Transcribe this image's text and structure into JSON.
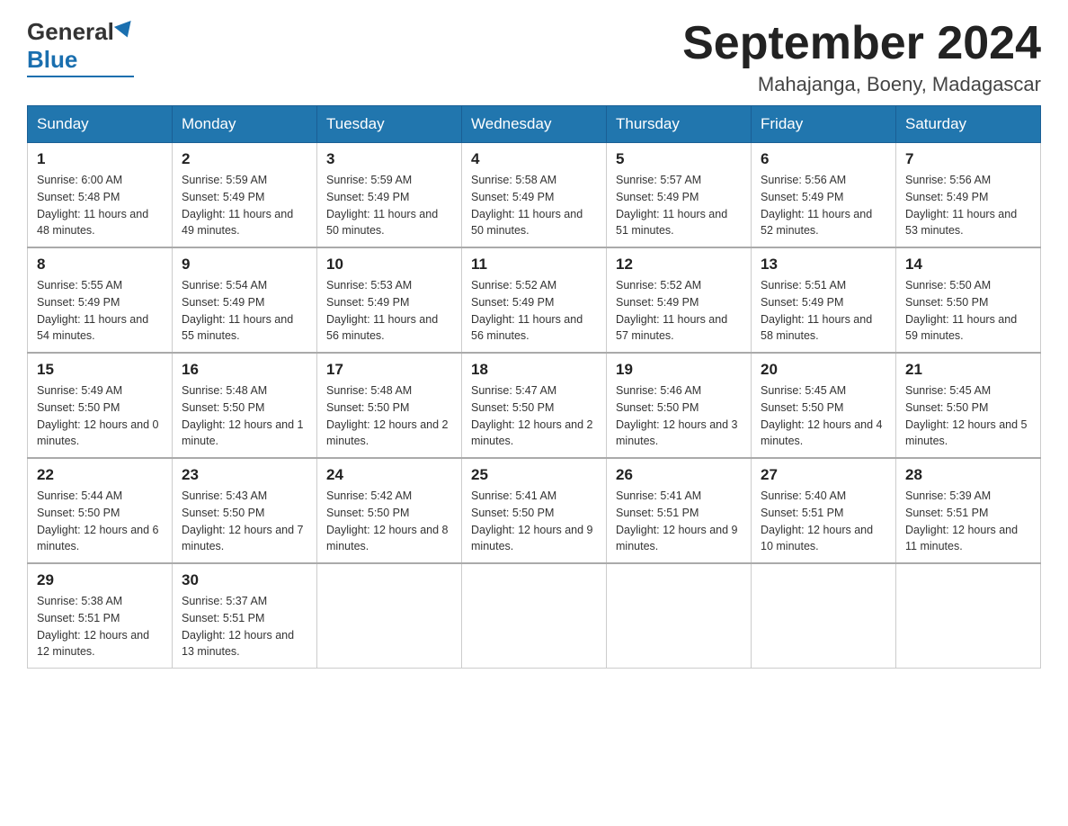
{
  "header": {
    "logo_general": "General",
    "logo_blue": "Blue",
    "title": "September 2024",
    "subtitle": "Mahajanga, Boeny, Madagascar"
  },
  "days_of_week": [
    "Sunday",
    "Monday",
    "Tuesday",
    "Wednesday",
    "Thursday",
    "Friday",
    "Saturday"
  ],
  "weeks": [
    [
      {
        "day": "1",
        "sunrise": "6:00 AM",
        "sunset": "5:48 PM",
        "daylight": "11 hours and 48 minutes."
      },
      {
        "day": "2",
        "sunrise": "5:59 AM",
        "sunset": "5:49 PM",
        "daylight": "11 hours and 49 minutes."
      },
      {
        "day": "3",
        "sunrise": "5:59 AM",
        "sunset": "5:49 PM",
        "daylight": "11 hours and 50 minutes."
      },
      {
        "day": "4",
        "sunrise": "5:58 AM",
        "sunset": "5:49 PM",
        "daylight": "11 hours and 50 minutes."
      },
      {
        "day": "5",
        "sunrise": "5:57 AM",
        "sunset": "5:49 PM",
        "daylight": "11 hours and 51 minutes."
      },
      {
        "day": "6",
        "sunrise": "5:56 AM",
        "sunset": "5:49 PM",
        "daylight": "11 hours and 52 minutes."
      },
      {
        "day": "7",
        "sunrise": "5:56 AM",
        "sunset": "5:49 PM",
        "daylight": "11 hours and 53 minutes."
      }
    ],
    [
      {
        "day": "8",
        "sunrise": "5:55 AM",
        "sunset": "5:49 PM",
        "daylight": "11 hours and 54 minutes."
      },
      {
        "day": "9",
        "sunrise": "5:54 AM",
        "sunset": "5:49 PM",
        "daylight": "11 hours and 55 minutes."
      },
      {
        "day": "10",
        "sunrise": "5:53 AM",
        "sunset": "5:49 PM",
        "daylight": "11 hours and 56 minutes."
      },
      {
        "day": "11",
        "sunrise": "5:52 AM",
        "sunset": "5:49 PM",
        "daylight": "11 hours and 56 minutes."
      },
      {
        "day": "12",
        "sunrise": "5:52 AM",
        "sunset": "5:49 PM",
        "daylight": "11 hours and 57 minutes."
      },
      {
        "day": "13",
        "sunrise": "5:51 AM",
        "sunset": "5:49 PM",
        "daylight": "11 hours and 58 minutes."
      },
      {
        "day": "14",
        "sunrise": "5:50 AM",
        "sunset": "5:50 PM",
        "daylight": "11 hours and 59 minutes."
      }
    ],
    [
      {
        "day": "15",
        "sunrise": "5:49 AM",
        "sunset": "5:50 PM",
        "daylight": "12 hours and 0 minutes."
      },
      {
        "day": "16",
        "sunrise": "5:48 AM",
        "sunset": "5:50 PM",
        "daylight": "12 hours and 1 minute."
      },
      {
        "day": "17",
        "sunrise": "5:48 AM",
        "sunset": "5:50 PM",
        "daylight": "12 hours and 2 minutes."
      },
      {
        "day": "18",
        "sunrise": "5:47 AM",
        "sunset": "5:50 PM",
        "daylight": "12 hours and 2 minutes."
      },
      {
        "day": "19",
        "sunrise": "5:46 AM",
        "sunset": "5:50 PM",
        "daylight": "12 hours and 3 minutes."
      },
      {
        "day": "20",
        "sunrise": "5:45 AM",
        "sunset": "5:50 PM",
        "daylight": "12 hours and 4 minutes."
      },
      {
        "day": "21",
        "sunrise": "5:45 AM",
        "sunset": "5:50 PM",
        "daylight": "12 hours and 5 minutes."
      }
    ],
    [
      {
        "day": "22",
        "sunrise": "5:44 AM",
        "sunset": "5:50 PM",
        "daylight": "12 hours and 6 minutes."
      },
      {
        "day": "23",
        "sunrise": "5:43 AM",
        "sunset": "5:50 PM",
        "daylight": "12 hours and 7 minutes."
      },
      {
        "day": "24",
        "sunrise": "5:42 AM",
        "sunset": "5:50 PM",
        "daylight": "12 hours and 8 minutes."
      },
      {
        "day": "25",
        "sunrise": "5:41 AM",
        "sunset": "5:50 PM",
        "daylight": "12 hours and 9 minutes."
      },
      {
        "day": "26",
        "sunrise": "5:41 AM",
        "sunset": "5:51 PM",
        "daylight": "12 hours and 9 minutes."
      },
      {
        "day": "27",
        "sunrise": "5:40 AM",
        "sunset": "5:51 PM",
        "daylight": "12 hours and 10 minutes."
      },
      {
        "day": "28",
        "sunrise": "5:39 AM",
        "sunset": "5:51 PM",
        "daylight": "12 hours and 11 minutes."
      }
    ],
    [
      {
        "day": "29",
        "sunrise": "5:38 AM",
        "sunset": "5:51 PM",
        "daylight": "12 hours and 12 minutes."
      },
      {
        "day": "30",
        "sunrise": "5:37 AM",
        "sunset": "5:51 PM",
        "daylight": "12 hours and 13 minutes."
      },
      null,
      null,
      null,
      null,
      null
    ]
  ]
}
